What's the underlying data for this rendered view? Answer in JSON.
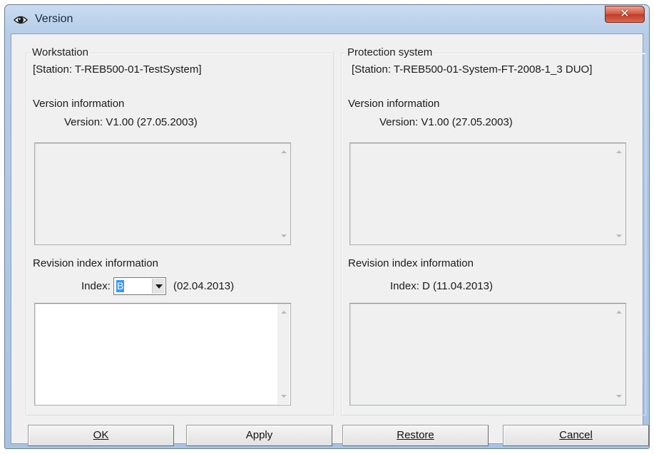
{
  "window": {
    "title": "Version",
    "close_glyph": "✕"
  },
  "workstation": {
    "group_title": "Workstation",
    "station": "[Station: T-REB500-01-TestSystem]",
    "version_heading": "Version information",
    "version_line": "Version:  V1.00 (27.05.2003)",
    "revision_heading": "Revision index information",
    "index_label": "Index:",
    "index_value": "B",
    "index_date": "(02.04.2013)"
  },
  "protection": {
    "group_title": "Protection system",
    "station": "[Station: T-REB500-01-System-FT-2008-1_3 DUO]",
    "version_heading": "Version information",
    "version_line": "Version:  V1.00 (27.05.2003)",
    "revision_heading": "Revision index information",
    "index_line": "Index:  D (11.04.2013)"
  },
  "buttons": {
    "ok": "OK",
    "apply": "Apply",
    "restore": "Restore",
    "cancel": "Cancel"
  },
  "icons": {
    "title_icon": "eye-icon",
    "close_icon": "close-icon"
  }
}
